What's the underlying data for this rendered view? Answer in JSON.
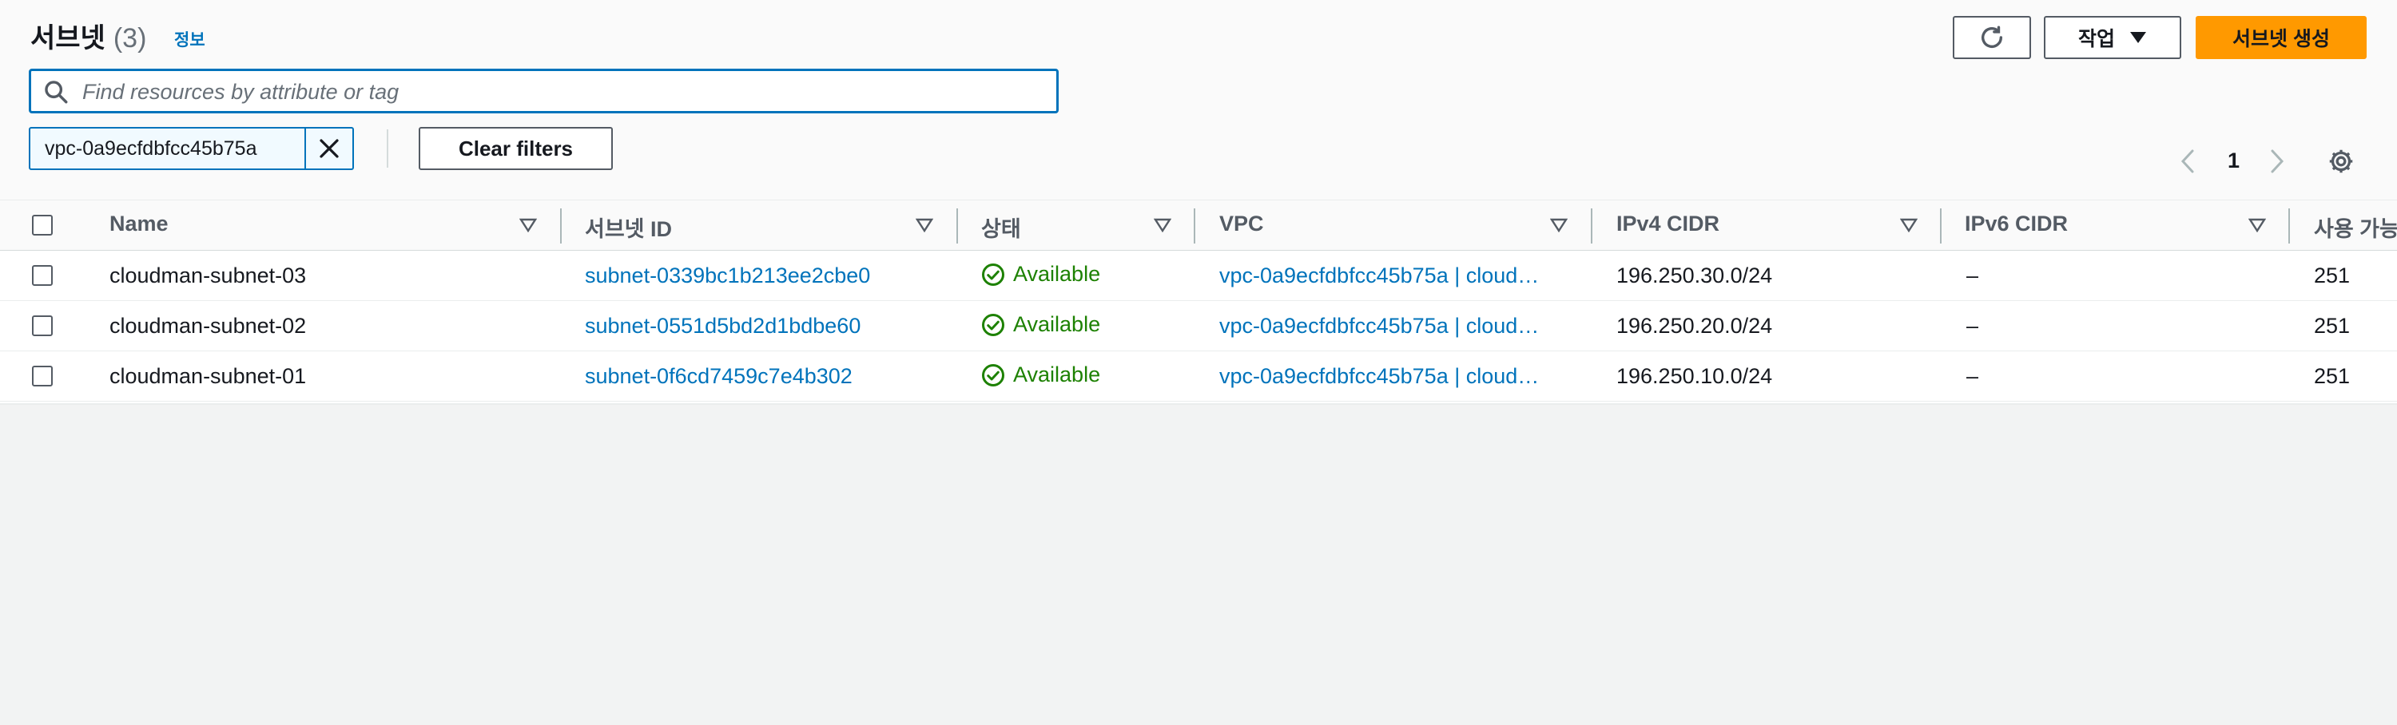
{
  "header": {
    "title": "서브넷",
    "count": "(3)",
    "info": "정보",
    "actions_label": "작업",
    "create_label": "서브넷 생성"
  },
  "search": {
    "placeholder": "Find resources by attribute or tag",
    "value": ""
  },
  "filter": {
    "token": "vpc-0a9ecfdbfcc45b75a",
    "clear_label": "Clear filters"
  },
  "pagination": {
    "current": "1"
  },
  "table": {
    "columns": [
      "Name",
      "서브넷 ID",
      "상태",
      "VPC",
      "IPv4 CIDR",
      "IPv6 CIDR",
      "사용 가능"
    ],
    "rows": [
      {
        "name": "cloudman-subnet-03",
        "subnet_id": "subnet-0339bc1b213ee2cbe0",
        "status": "Available",
        "vpc": "vpc-0a9ecfdbfcc45b75a | cloud…",
        "ipv4": "196.250.30.0/24",
        "ipv6": "–",
        "available": "251"
      },
      {
        "name": "cloudman-subnet-02",
        "subnet_id": "subnet-0551d5bd2d1bdbe60",
        "status": "Available",
        "vpc": "vpc-0a9ecfdbfcc45b75a | cloud…",
        "ipv4": "196.250.20.0/24",
        "ipv6": "–",
        "available": "251"
      },
      {
        "name": "cloudman-subnet-01",
        "subnet_id": "subnet-0f6cd7459c7e4b302",
        "status": "Available",
        "vpc": "vpc-0a9ecfdbfcc45b75a | cloud…",
        "ipv4": "196.250.10.0/24",
        "ipv6": "–",
        "available": "251"
      }
    ]
  },
  "icons": {
    "search": "search-icon",
    "refresh": "refresh-icon",
    "caret": "caret-down-icon",
    "close": "close-icon",
    "prev": "chevron-left-icon",
    "next": "chevron-right-icon",
    "settings": "gear-icon",
    "sort": "sort-caret-icon",
    "status": "check-circle-icon"
  },
  "colors": {
    "primary": "#ff9900",
    "link": "#0073bb",
    "success": "#1d8102"
  }
}
